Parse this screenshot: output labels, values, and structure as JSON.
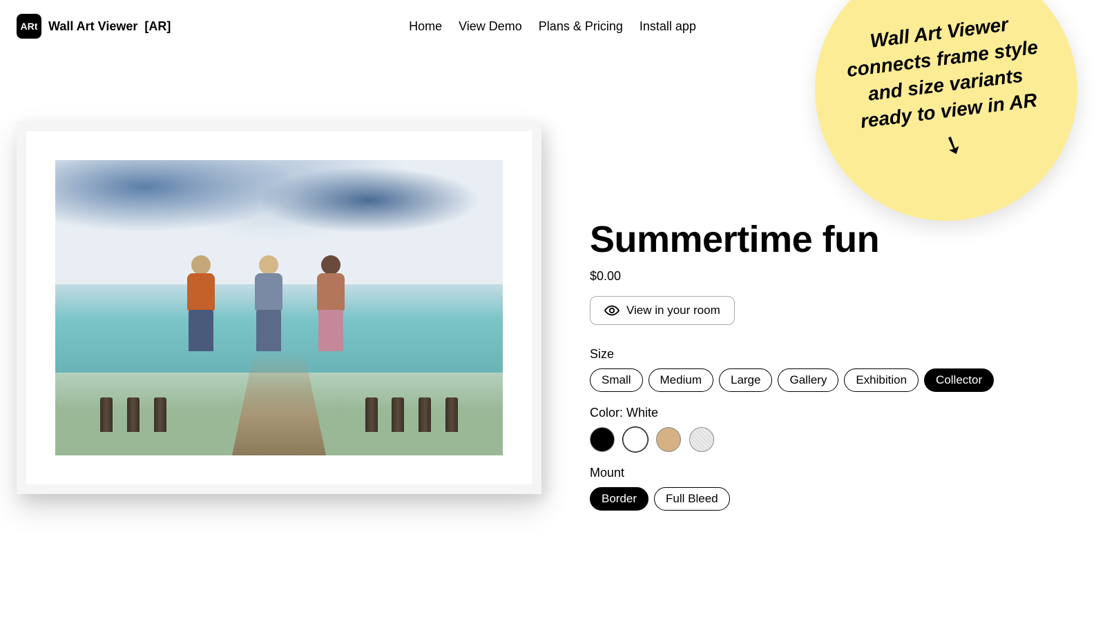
{
  "brand": {
    "logo_text": "ARt",
    "name": "Wall Art Viewer",
    "suffix": "[AR]"
  },
  "nav": {
    "home": "Home",
    "demo": "View Demo",
    "pricing": "Plans & Pricing",
    "install": "Install app"
  },
  "product": {
    "title": "Summertime fun",
    "price": "$0.00",
    "view_room_label": "View in your room"
  },
  "size": {
    "label": "Size",
    "options": [
      "Small",
      "Medium",
      "Large",
      "Gallery",
      "Exhibition",
      "Collector"
    ],
    "selected": "Collector"
  },
  "color": {
    "label": "Color: White",
    "options": [
      {
        "name": "Black",
        "hex": "#000000"
      },
      {
        "name": "White",
        "hex": "#ffffff"
      },
      {
        "name": "Oak",
        "hex": "#d6b184"
      },
      {
        "name": "Natural",
        "hex": "#e5e5e5"
      }
    ],
    "selected": "White"
  },
  "mount": {
    "label": "Mount",
    "options": [
      "Border",
      "Full Bleed"
    ],
    "selected": "Border"
  },
  "callout": {
    "text": "Wall Art Viewer connects frame style and size variants ready to view in AR"
  }
}
